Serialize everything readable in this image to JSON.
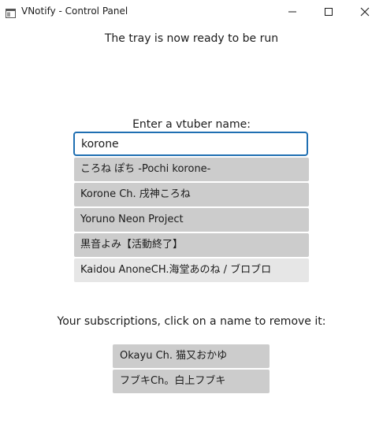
{
  "window": {
    "title": "VNotify - Control Panel",
    "icon": "app-window-icon",
    "controls": [
      "minimize-icon",
      "maximize-icon",
      "close-icon"
    ]
  },
  "status": {
    "message": "The tray is now ready to be run"
  },
  "search": {
    "label": "Enter a vtuber name:",
    "value": "korone",
    "accent_color": "#1f6fb2",
    "suggestions": [
      {
        "label": "ころね ぽち -Pochi korone-"
      },
      {
        "label": "Korone Ch. 戌神ころね"
      },
      {
        "label": "Yoruno Neon Project"
      },
      {
        "label": "黒音よみ【活動終了】"
      },
      {
        "label": "Kaidou AnoneCH.海堂あのね / ブロブロ"
      }
    ]
  },
  "subscriptions": {
    "label": "Your subscriptions, click on a name to remove it:",
    "items": [
      {
        "label": "Okayu Ch. 猫又おかゆ"
      },
      {
        "label": "フブキCh。白上フブキ"
      }
    ]
  },
  "colors": {
    "item_background": "#cccccc",
    "item_hover_background": "#e6e6e6"
  }
}
